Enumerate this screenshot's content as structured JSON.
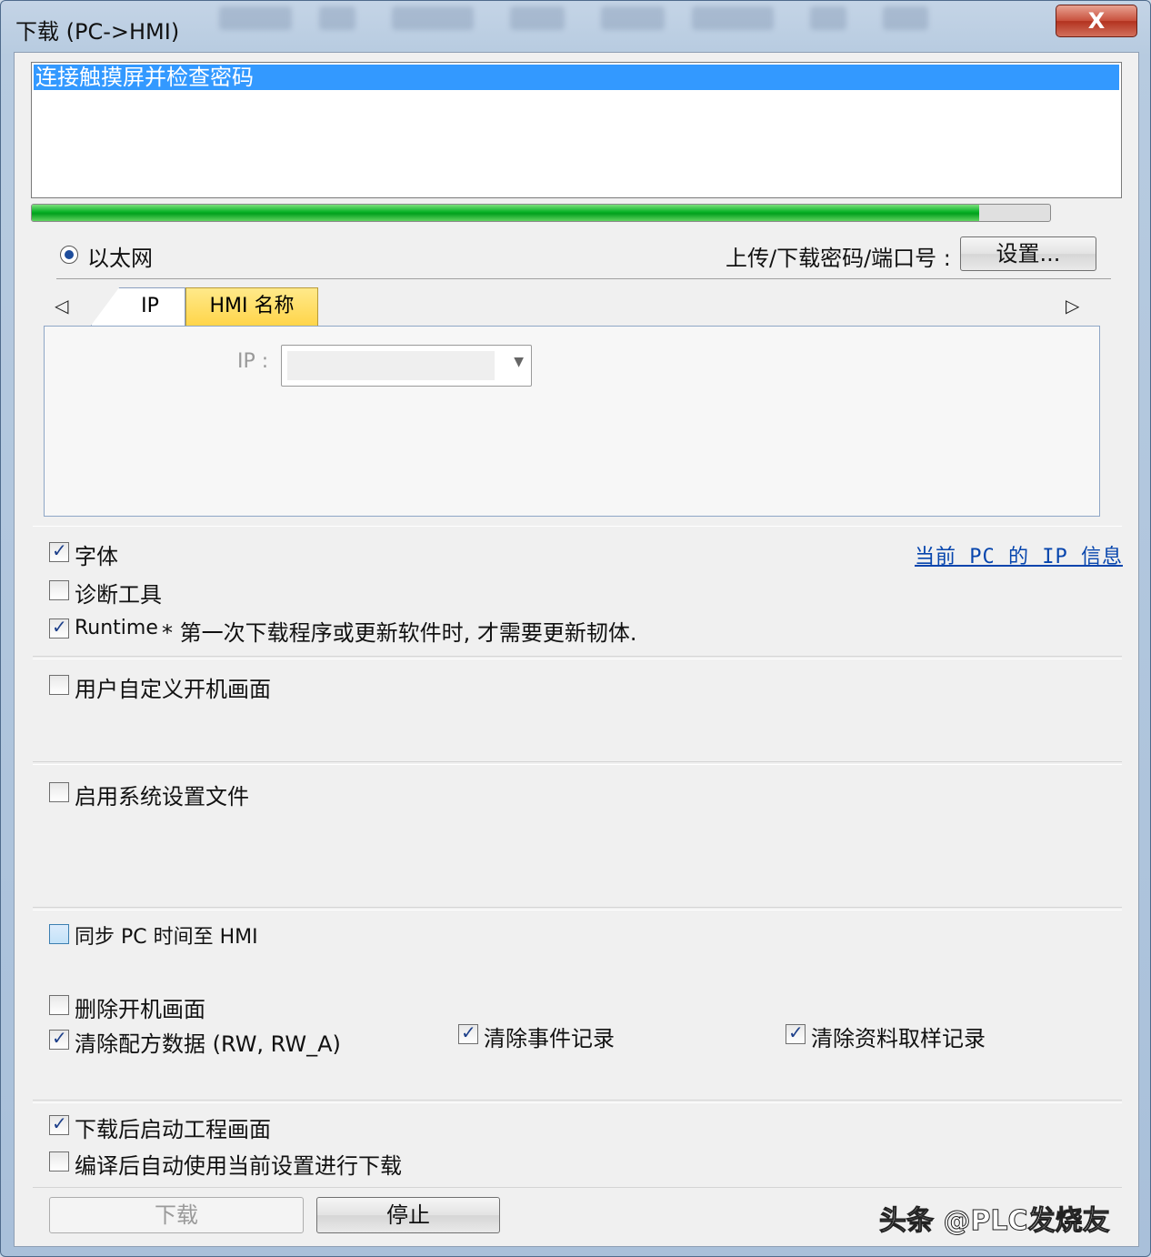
{
  "window": {
    "title": "下载 (PC->HMI)",
    "close_label": "X"
  },
  "log": {
    "items": [
      "连接触摸屏并检查密码"
    ]
  },
  "progress": {
    "percent": 93
  },
  "connection": {
    "ethernet_label": "以太网",
    "ethernet_selected": true,
    "password_label": "上传/下载密码/端口号 :",
    "settings_button": "设置..."
  },
  "tabs": {
    "ip_label": "IP",
    "hmi_name_label": "HMI 名称",
    "ip_field_label": "IP :",
    "ip_value": ""
  },
  "options": {
    "font_label": "字体",
    "font_checked": true,
    "diag_label": "诊断工具",
    "diag_checked": false,
    "runtime_label": "Runtime",
    "runtime_checked": true,
    "runtime_note": "* 第一次下载程序或更新软件时, 才需要更新韧体.",
    "pc_ip_link": "当前 PC 的 IP 信息",
    "custom_boot_label": "用户自定义开机画面",
    "custom_boot_checked": false,
    "system_settings_label": "启用系统设置文件",
    "system_settings_checked": false,
    "sync_time_label": "同步 PC 时间至 HMI",
    "sync_time_checked": false,
    "delete_boot_label": "删除开机画面",
    "delete_boot_checked": false,
    "clear_recipe_label": "清除配方数据 (RW, RW_A)",
    "clear_recipe_checked": true,
    "clear_event_label": "清除事件记录",
    "clear_event_checked": true,
    "clear_sampling_label": "清除资料取样记录",
    "clear_sampling_checked": true,
    "start_after_label": "下载后启动工程画面",
    "start_after_checked": true,
    "auto_download_label": "编译后自动使用当前设置进行下载",
    "auto_download_checked": false
  },
  "buttons": {
    "download": "下载",
    "stop": "停止"
  },
  "watermark": "头条 @PLC发烧友"
}
